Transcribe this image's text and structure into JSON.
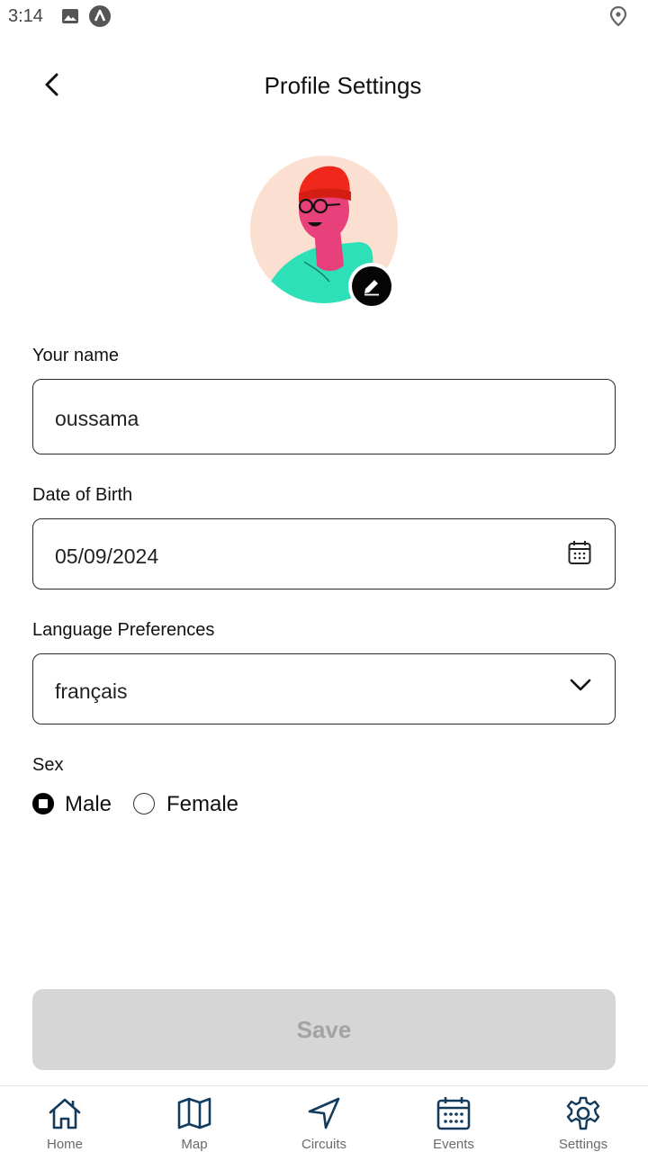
{
  "status_bar": {
    "time": "3:14",
    "icons": [
      "image-icon",
      "app-logo-icon",
      "location-pin-icon"
    ]
  },
  "header": {
    "title": "Profile Settings",
    "back_icon": "chevron-left-icon"
  },
  "avatar": {
    "edit_icon": "pencil-icon"
  },
  "form": {
    "name": {
      "label": "Your name",
      "value": "oussama"
    },
    "dob": {
      "label": "Date of Birth",
      "value": "05/09/2024",
      "icon": "calendar-icon"
    },
    "language": {
      "label": "Language Preferences",
      "value": "français",
      "icon": "chevron-down-icon"
    },
    "sex": {
      "label": "Sex",
      "options": [
        {
          "label": "Male",
          "selected": true
        },
        {
          "label": "Female",
          "selected": false
        }
      ]
    }
  },
  "save_button": {
    "label": "Save"
  },
  "bottom_nav": {
    "accent": "#123b5e",
    "items": [
      {
        "label": "Home",
        "icon": "home-icon"
      },
      {
        "label": "Map",
        "icon": "map-icon"
      },
      {
        "label": "Circuits",
        "icon": "navigation-arrow-icon"
      },
      {
        "label": "Events",
        "icon": "calendar-icon"
      },
      {
        "label": "Settings",
        "icon": "gear-icon"
      }
    ]
  }
}
